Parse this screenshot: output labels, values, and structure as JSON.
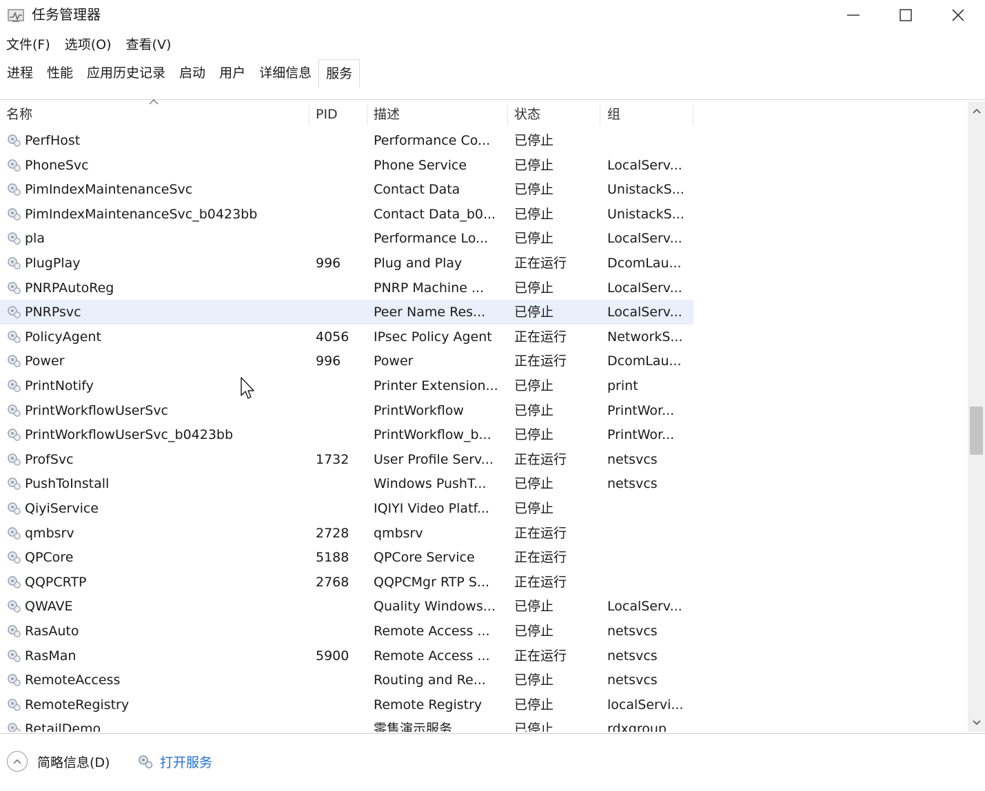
{
  "window": {
    "title": "任务管理器"
  },
  "menu": [
    "文件(F)",
    "选项(O)",
    "查看(V)"
  ],
  "tabs": [
    {
      "label": "进程",
      "active": false
    },
    {
      "label": "性能",
      "active": false
    },
    {
      "label": "应用历史记录",
      "active": false
    },
    {
      "label": "启动",
      "active": false
    },
    {
      "label": "用户",
      "active": false
    },
    {
      "label": "详细信息",
      "active": false
    },
    {
      "label": "服务",
      "active": true
    }
  ],
  "columns": {
    "name": "名称",
    "pid": "PID",
    "description": "描述",
    "status": "状态",
    "group": "组"
  },
  "services": [
    {
      "name": "PerfHost",
      "pid": "",
      "description": "Performance Co...",
      "status": "已停止",
      "group": ""
    },
    {
      "name": "PhoneSvc",
      "pid": "",
      "description": "Phone Service",
      "status": "已停止",
      "group": "LocalServ..."
    },
    {
      "name": "PimIndexMaintenanceSvc",
      "pid": "",
      "description": "Contact Data",
      "status": "已停止",
      "group": "UnistackS..."
    },
    {
      "name": "PimIndexMaintenanceSvc_b0423bb",
      "pid": "",
      "description": "Contact Data_b0...",
      "status": "已停止",
      "group": "UnistackS..."
    },
    {
      "name": "pla",
      "pid": "",
      "description": "Performance Lo...",
      "status": "已停止",
      "group": "LocalServ..."
    },
    {
      "name": "PlugPlay",
      "pid": "996",
      "description": "Plug and Play",
      "status": "正在运行",
      "group": "DcomLau..."
    },
    {
      "name": "PNRPAutoReg",
      "pid": "",
      "description": "PNRP Machine ...",
      "status": "已停止",
      "group": "LocalServ..."
    },
    {
      "name": "PNRPsvc",
      "pid": "",
      "description": "Peer Name Res...",
      "status": "已停止",
      "group": "LocalServ...",
      "highlight": true
    },
    {
      "name": "PolicyAgent",
      "pid": "4056",
      "description": "IPsec Policy Agent",
      "status": "正在运行",
      "group": "NetworkS..."
    },
    {
      "name": "Power",
      "pid": "996",
      "description": "Power",
      "status": "正在运行",
      "group": "DcomLau..."
    },
    {
      "name": "PrintNotify",
      "pid": "",
      "description": "Printer Extension...",
      "status": "已停止",
      "group": "print"
    },
    {
      "name": "PrintWorkflowUserSvc",
      "pid": "",
      "description": "PrintWorkflow",
      "status": "已停止",
      "group": "PrintWor..."
    },
    {
      "name": "PrintWorkflowUserSvc_b0423bb",
      "pid": "",
      "description": "PrintWorkflow_b...",
      "status": "已停止",
      "group": "PrintWor..."
    },
    {
      "name": "ProfSvc",
      "pid": "1732",
      "description": "User Profile Serv...",
      "status": "正在运行",
      "group": "netsvcs"
    },
    {
      "name": "PushToInstall",
      "pid": "",
      "description": "Windows PushT...",
      "status": "已停止",
      "group": "netsvcs"
    },
    {
      "name": "QiyiService",
      "pid": "",
      "description": "IQIYI Video Platf...",
      "status": "已停止",
      "group": ""
    },
    {
      "name": "qmbsrv",
      "pid": "2728",
      "description": "qmbsrv",
      "status": "正在运行",
      "group": ""
    },
    {
      "name": "QPCore",
      "pid": "5188",
      "description": "QPCore Service",
      "status": "正在运行",
      "group": ""
    },
    {
      "name": "QQPCRTP",
      "pid": "2768",
      "description": "QQPCMgr RTP S...",
      "status": "正在运行",
      "group": ""
    },
    {
      "name": "QWAVE",
      "pid": "",
      "description": "Quality Windows...",
      "status": "已停止",
      "group": "LocalServ..."
    },
    {
      "name": "RasAuto",
      "pid": "",
      "description": "Remote Access ...",
      "status": "已停止",
      "group": "netsvcs"
    },
    {
      "name": "RasMan",
      "pid": "5900",
      "description": "Remote Access ...",
      "status": "正在运行",
      "group": "netsvcs"
    },
    {
      "name": "RemoteAccess",
      "pid": "",
      "description": "Routing and Re...",
      "status": "已停止",
      "group": "netsvcs"
    },
    {
      "name": "RemoteRegistry",
      "pid": "",
      "description": "Remote Registry",
      "status": "已停止",
      "group": "localServi..."
    },
    {
      "name": "RetailDemo",
      "pid": "",
      "description": "零售演示服务",
      "status": "已停止",
      "group": "rdxgroup"
    }
  ],
  "footer": {
    "fewer_details": "简略信息(D)",
    "open_services": "打开服务"
  }
}
